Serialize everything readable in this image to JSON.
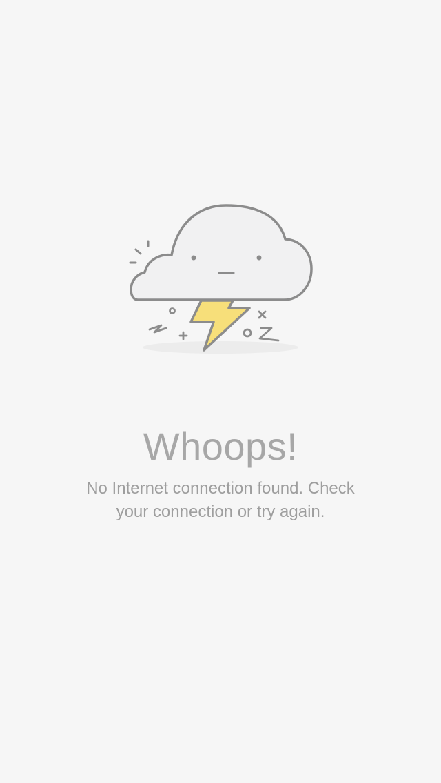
{
  "error_screen": {
    "title": "Whoops!",
    "message": "No Internet connection found. Check\nyour connection or try again.",
    "illustration_icon": "storm-cloud-icon"
  },
  "colors": {
    "background": "#f6f6f6",
    "text": "#a7a7a7",
    "outline": "#8c8c8c",
    "cloud_fill": "#f2f2f3",
    "lightning_fill": "#f7df7a"
  }
}
